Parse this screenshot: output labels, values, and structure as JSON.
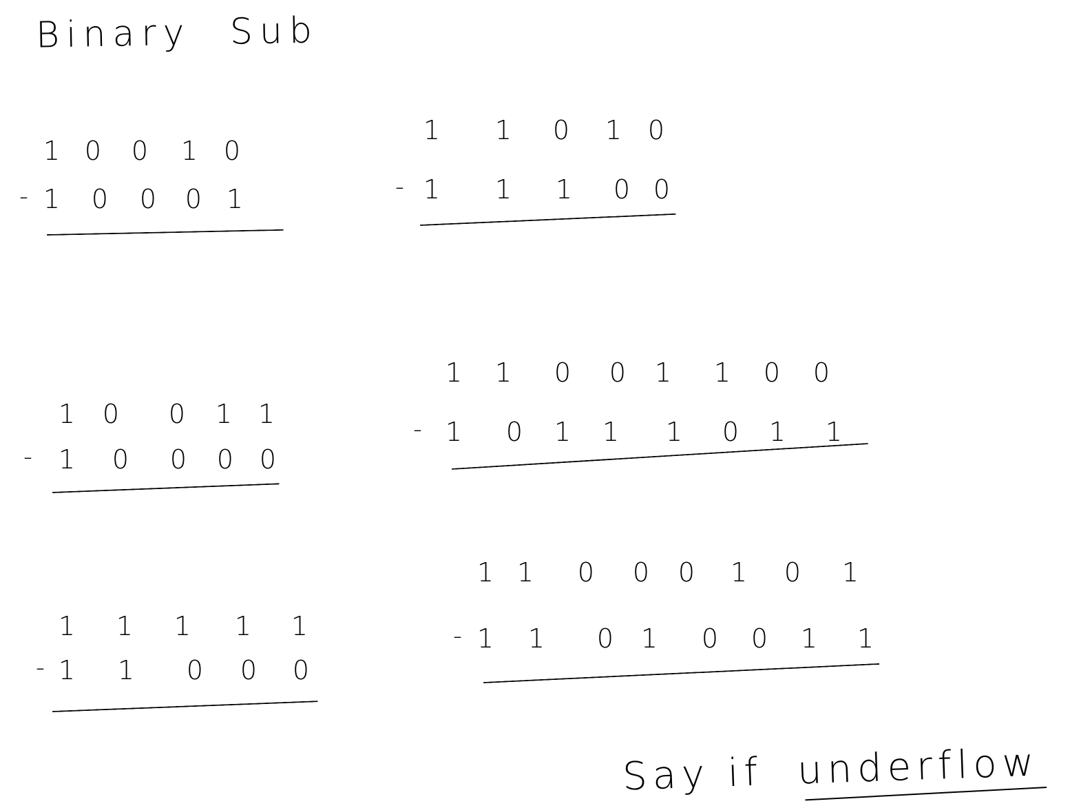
{
  "title": "Binary Sub",
  "minus_sign": "-",
  "problems": [
    {
      "top": [
        "1",
        "0",
        "0",
        "1",
        "0"
      ],
      "bottom": [
        "1",
        "0",
        "0",
        "0",
        "1"
      ]
    },
    {
      "top": [
        "1",
        "1",
        "0",
        "1",
        "0"
      ],
      "bottom": [
        "1",
        "1",
        "1",
        "0",
        "0"
      ]
    },
    {
      "top": [
        "1",
        "0",
        "0",
        "1",
        "1"
      ],
      "bottom": [
        "1",
        "0",
        "0",
        "0",
        "0"
      ]
    },
    {
      "top": [
        "1",
        "1",
        "0",
        "0",
        "1",
        "1",
        "0",
        "0"
      ],
      "bottom": [
        "1",
        "0",
        "1",
        "1",
        "1",
        "0",
        "1",
        "1"
      ]
    },
    {
      "top": [
        "1",
        "1",
        "1",
        "1",
        "1"
      ],
      "bottom": [
        "1",
        "1",
        "0",
        "0",
        "0"
      ]
    },
    {
      "top": [
        "1",
        "1",
        "0",
        "0",
        "0",
        "1",
        "0",
        "1"
      ],
      "bottom": [
        "1",
        "1",
        "0",
        "1",
        "0",
        "0",
        "1",
        "1"
      ]
    }
  ],
  "note": {
    "prefix": "Say if",
    "emphasis": "underflow"
  }
}
